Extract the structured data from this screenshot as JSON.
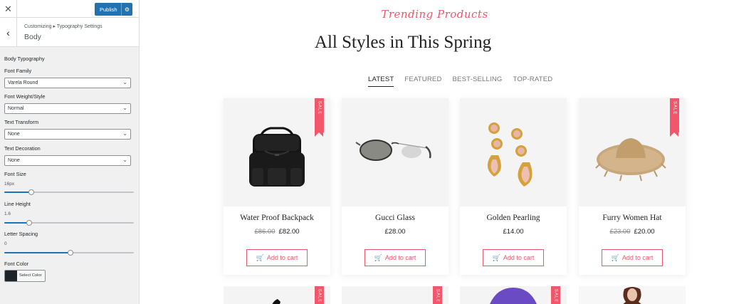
{
  "sidebar": {
    "close_icon": "close-icon",
    "publish_label": "Publish",
    "publish_settings_icon": "gear-icon",
    "back_icon": "chevron-left-icon",
    "breadcrumb": "Customizing ▸ Typography Settings",
    "section_title": "Body",
    "group_label": "Body Typography",
    "font_family": {
      "label": "Font Family",
      "value": "Varela Round"
    },
    "font_weight": {
      "label": "Font Weight/Style",
      "value": "Normal"
    },
    "text_transform": {
      "label": "Text Transform",
      "value": "None"
    },
    "text_decoration": {
      "label": "Text Decoration",
      "value": "None"
    },
    "font_size": {
      "label": "Font Size",
      "value": "16px",
      "fraction": 0.21
    },
    "line_height": {
      "label": "Line Height",
      "value": "1.6",
      "fraction": 0.19
    },
    "letter_spacing": {
      "label": "Letter Spacing",
      "value": "0",
      "fraction": 0.51
    },
    "font_color": {
      "label": "Font Color",
      "button_label": "Select Color",
      "swatch": "#1d2327"
    },
    "accent_color": "#2271b1"
  },
  "preview": {
    "script_title": "Trending Products",
    "heading": "All Styles in This Spring",
    "tabs": [
      {
        "label": "LATEST",
        "active": true
      },
      {
        "label": "FEATURED",
        "active": false
      },
      {
        "label": "BEST-SELLING",
        "active": false
      },
      {
        "label": "TOP-RATED",
        "active": false
      }
    ],
    "sale_badge": "SALE",
    "cart_label": "Add to cart",
    "cart_icon": "cart-icon",
    "accent_color": "#ec5769",
    "products": [
      {
        "name": "Water Proof Backpack",
        "old_price": "£86.00",
        "price": "£82.00",
        "sale": true,
        "image": "backpack"
      },
      {
        "name": "Gucci Glass",
        "old_price": "",
        "price": "£28.00",
        "sale": false,
        "image": "sunglasses"
      },
      {
        "name": "Golden Pearling",
        "old_price": "",
        "price": "£14.00",
        "sale": false,
        "image": "earrings"
      },
      {
        "name": "Furry Women Hat",
        "old_price": "£23.00",
        "price": "£20.00",
        "sale": true,
        "image": "straw-hat"
      }
    ]
  }
}
